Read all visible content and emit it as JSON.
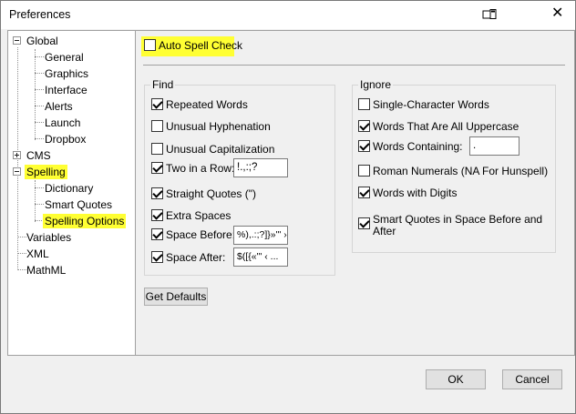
{
  "window": {
    "title": "Preferences"
  },
  "tree": {
    "global": "Global",
    "general": "General",
    "graphics": "Graphics",
    "interface": "Interface",
    "alerts": "Alerts",
    "launch": "Launch",
    "dropbox": "Dropbox",
    "cms": "CMS",
    "spelling": "Spelling",
    "dictionary": "Dictionary",
    "smart_quotes": "Smart Quotes",
    "spelling_options": "Spelling Options",
    "variables": "Variables",
    "xml": "XML",
    "mathml": "MathML"
  },
  "auto_spell_check": {
    "label": "Auto Spell Check",
    "checked": false
  },
  "find": {
    "title": "Find",
    "repeated_words": {
      "label": "Repeated Words",
      "checked": true
    },
    "unusual_hyphenation": {
      "label": "Unusual Hyphenation",
      "checked": false
    },
    "unusual_capitalization": {
      "label": "Unusual Capitalization",
      "checked": false
    },
    "two_in_a_row": {
      "label": "Two in a Row:",
      "checked": true,
      "value": "!.,:;?"
    },
    "straight_quotes": {
      "label": "Straight Quotes (\")",
      "checked": true
    },
    "extra_spaces": {
      "label": "Extra Spaces",
      "checked": true
    },
    "space_before": {
      "label": "Space Before:",
      "checked": true,
      "value": "%),.:;?]}»\"' ›"
    },
    "space_after": {
      "label": "Space After:",
      "checked": true,
      "value": "$([{«\"' ‹ ..."
    }
  },
  "ignore": {
    "title": "Ignore",
    "single_character": {
      "label": "Single-Character Words",
      "checked": false
    },
    "all_uppercase": {
      "label": "Words That Are All Uppercase",
      "checked": true
    },
    "words_containing": {
      "label": "Words Containing:",
      "checked": true,
      "value": "."
    },
    "roman_numerals": {
      "label": "Roman Numerals (NA For Hunspell)",
      "checked": false
    },
    "words_with_digits": {
      "label": "Words with Digits",
      "checked": true
    },
    "smart_quotes_space": {
      "label_line1": "Smart Quotes in Space Before and",
      "label_line2": "After",
      "checked": true
    }
  },
  "buttons": {
    "get_defaults": "Get Defaults",
    "ok": "OK",
    "cancel": "Cancel"
  },
  "colors": {
    "highlight": "#ffff33",
    "dialog_bg": "#f0f0f0"
  }
}
